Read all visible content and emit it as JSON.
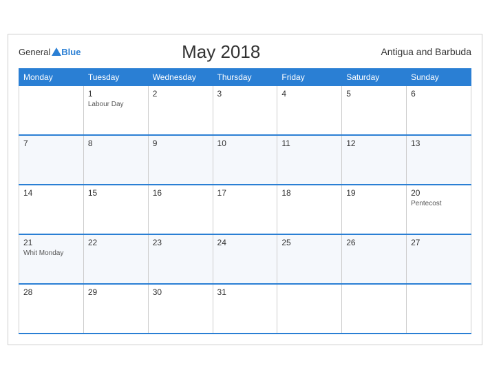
{
  "header": {
    "logo_general": "General",
    "logo_blue": "Blue",
    "title": "May 2018",
    "country": "Antigua and Barbuda"
  },
  "weekdays": [
    "Monday",
    "Tuesday",
    "Wednesday",
    "Thursday",
    "Friday",
    "Saturday",
    "Sunday"
  ],
  "weeks": [
    [
      {
        "day": "",
        "holiday": ""
      },
      {
        "day": "1",
        "holiday": "Labour Day"
      },
      {
        "day": "2",
        "holiday": ""
      },
      {
        "day": "3",
        "holiday": ""
      },
      {
        "day": "4",
        "holiday": ""
      },
      {
        "day": "5",
        "holiday": ""
      },
      {
        "day": "6",
        "holiday": ""
      }
    ],
    [
      {
        "day": "7",
        "holiday": ""
      },
      {
        "day": "8",
        "holiday": ""
      },
      {
        "day": "9",
        "holiday": ""
      },
      {
        "day": "10",
        "holiday": ""
      },
      {
        "day": "11",
        "holiday": ""
      },
      {
        "day": "12",
        "holiday": ""
      },
      {
        "day": "13",
        "holiday": ""
      }
    ],
    [
      {
        "day": "14",
        "holiday": ""
      },
      {
        "day": "15",
        "holiday": ""
      },
      {
        "day": "16",
        "holiday": ""
      },
      {
        "day": "17",
        "holiday": ""
      },
      {
        "day": "18",
        "holiday": ""
      },
      {
        "day": "19",
        "holiday": ""
      },
      {
        "day": "20",
        "holiday": "Pentecost"
      }
    ],
    [
      {
        "day": "21",
        "holiday": "Whit Monday"
      },
      {
        "day": "22",
        "holiday": ""
      },
      {
        "day": "23",
        "holiday": ""
      },
      {
        "day": "24",
        "holiday": ""
      },
      {
        "day": "25",
        "holiday": ""
      },
      {
        "day": "26",
        "holiday": ""
      },
      {
        "day": "27",
        "holiday": ""
      }
    ],
    [
      {
        "day": "28",
        "holiday": ""
      },
      {
        "day": "29",
        "holiday": ""
      },
      {
        "day": "30",
        "holiday": ""
      },
      {
        "day": "31",
        "holiday": ""
      },
      {
        "day": "",
        "holiday": ""
      },
      {
        "day": "",
        "holiday": ""
      },
      {
        "day": "",
        "holiday": ""
      }
    ]
  ]
}
